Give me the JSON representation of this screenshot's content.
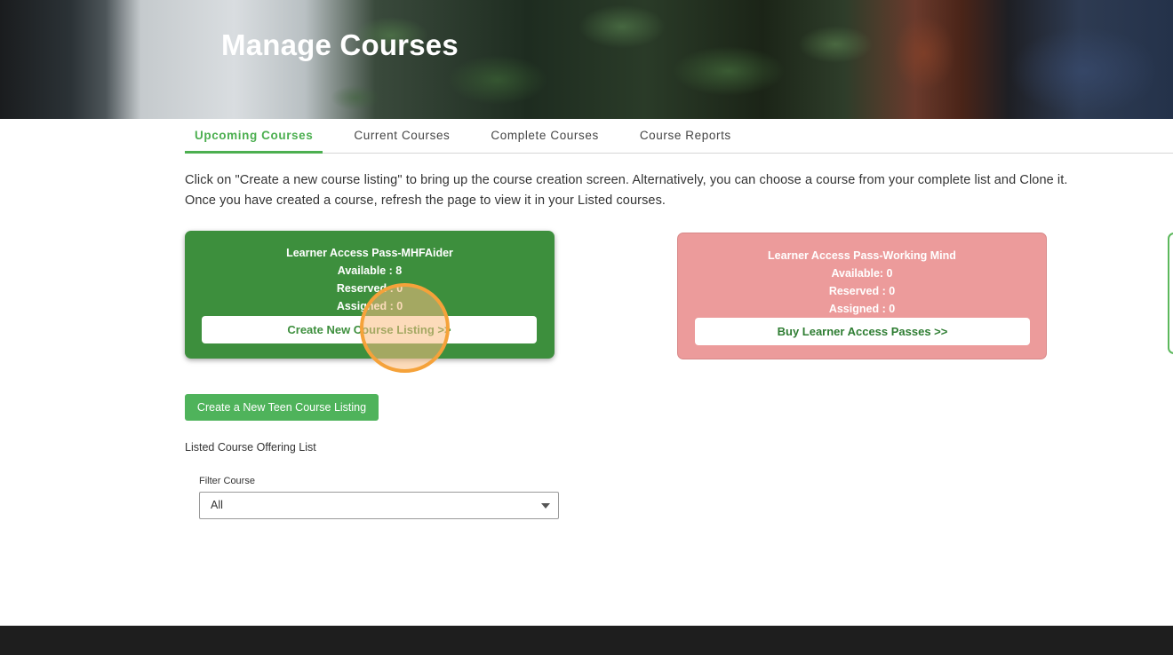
{
  "header": {
    "title": "Manage Courses"
  },
  "tabs": [
    {
      "label": "Upcoming Courses",
      "active": true
    },
    {
      "label": "Current Courses",
      "active": false
    },
    {
      "label": "Complete Courses",
      "active": false
    },
    {
      "label": "Course Reports",
      "active": false
    }
  ],
  "intro": {
    "line1": "Click on \"Create a new course listing\" to bring up the course creation screen. Alternatively, you can choose a course from your complete list and Clone it.",
    "line2": "Once you have created a course, refresh the page to view it in your Listed courses."
  },
  "cards": [
    {
      "title": "Learner Access Pass-MHFAider",
      "available": "Available : 8",
      "reserved": "Reserved : 0",
      "assigned": "Assigned : 0",
      "button": "Create New Course Listing >>",
      "color": "#3d8f3d"
    },
    {
      "title": "Learner Access Pass-Working Mind",
      "available": "Available: 0",
      "reserved": "Reserved : 0",
      "assigned": "Assigned : 0",
      "button": "Buy Learner Access Passes >>",
      "color": "#ec9b9b"
    }
  ],
  "teen_button": "Create a New Teen Course Listing",
  "listed": {
    "title": "Listed Course Offering List",
    "filter_label": "Filter Course",
    "filter_value": "All"
  },
  "colors": {
    "accent": "#4caf50",
    "footer": "#1e1e1e",
    "highlight": "#f5a23a"
  },
  "icons": {
    "select_caret": "chevron-down-icon",
    "click_marker": "click-highlight-circle"
  }
}
